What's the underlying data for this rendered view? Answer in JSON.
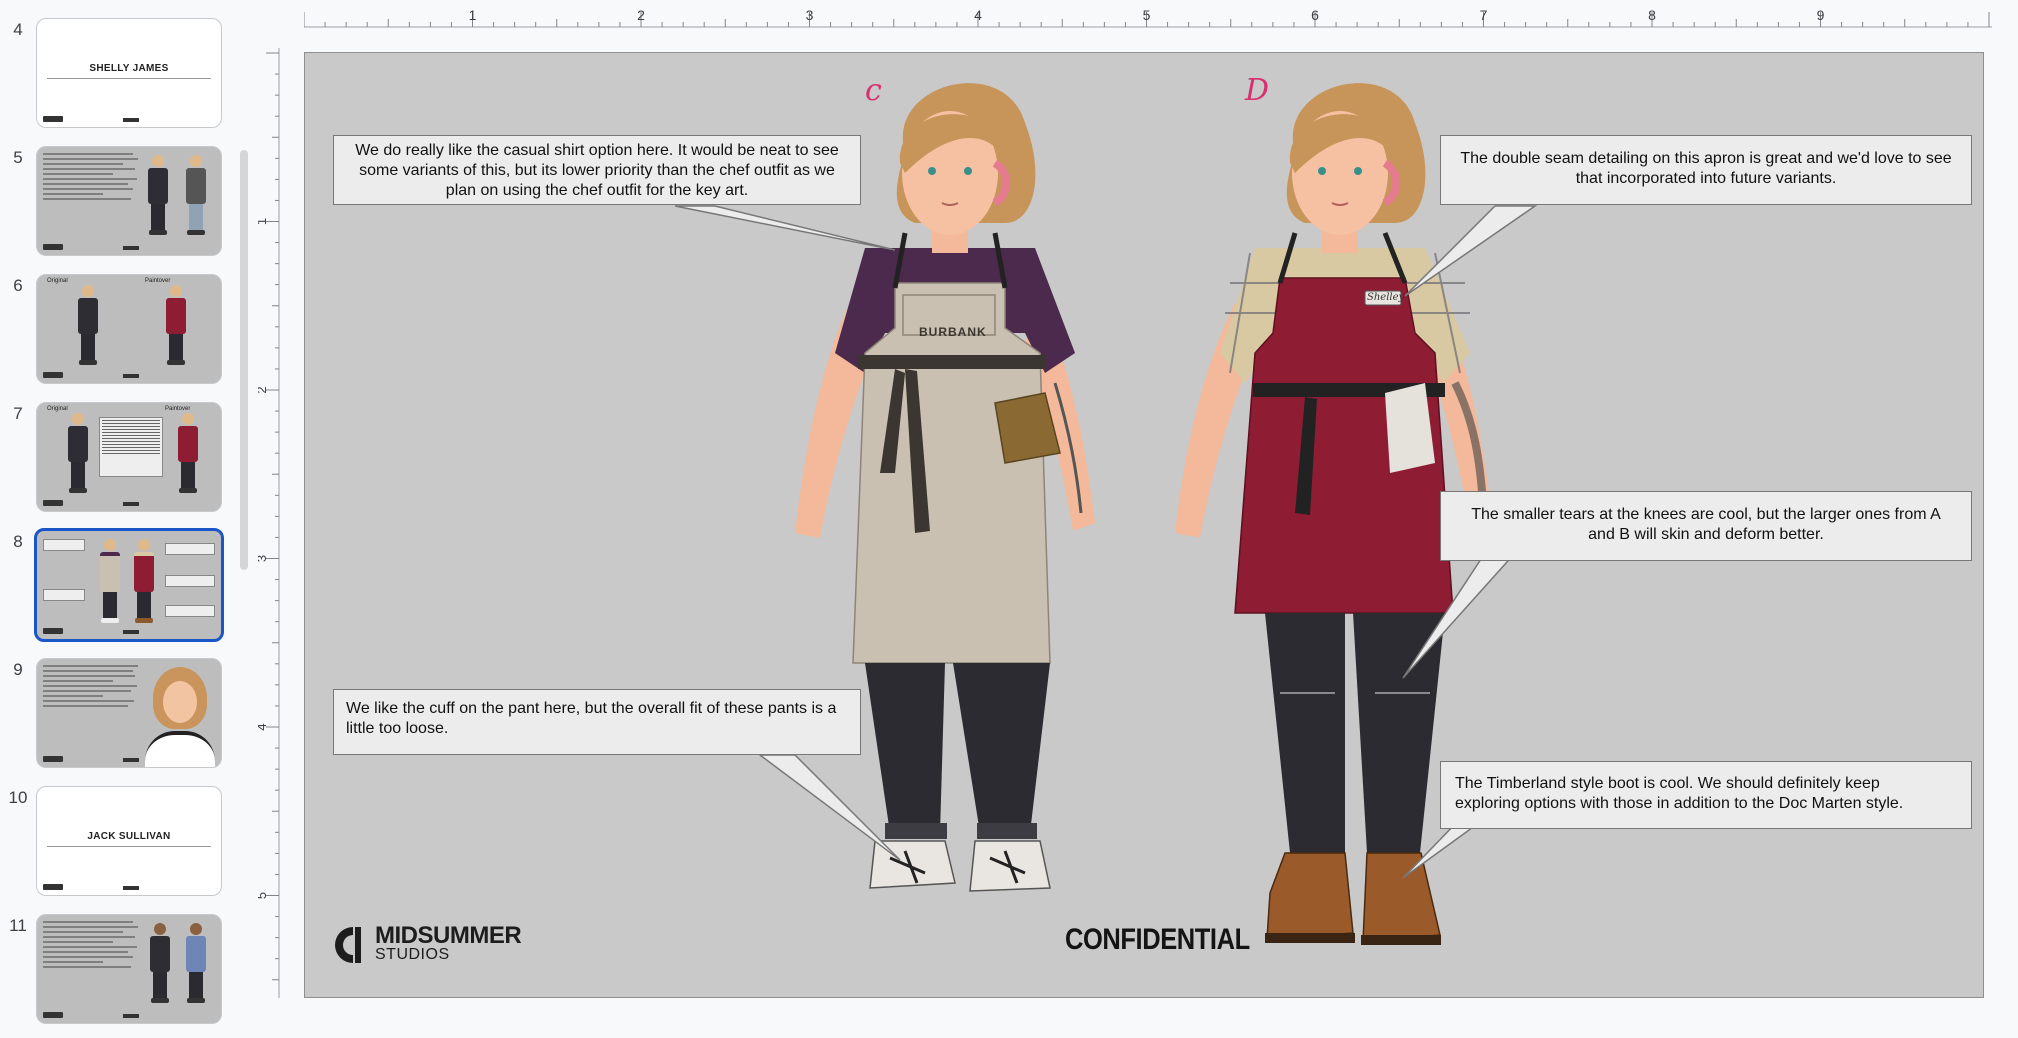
{
  "filmstrip": {
    "slides": [
      {
        "number": "4",
        "title": "SHELLY JAMES",
        "kind": "title"
      },
      {
        "number": "5",
        "kind": "text-figures"
      },
      {
        "number": "6",
        "label_left": "Original",
        "label_right": "Paintover",
        "kind": "compare"
      },
      {
        "number": "7",
        "label_left": "Original",
        "label_right": "Paintover",
        "kind": "compare-notes"
      },
      {
        "number": "8",
        "kind": "callouts",
        "selected": true
      },
      {
        "number": "9",
        "kind": "portrait"
      },
      {
        "number": "10",
        "title": "JACK SULLIVAN",
        "kind": "title"
      },
      {
        "number": "11",
        "kind": "text-figures"
      }
    ]
  },
  "rulers": {
    "horizontal": [
      "1",
      "2",
      "3",
      "4",
      "5",
      "6",
      "7",
      "8",
      "9"
    ],
    "vertical": [
      "1",
      "2",
      "3",
      "4",
      "5"
    ]
  },
  "slide": {
    "letters": {
      "left": "c",
      "right": "D"
    },
    "callouts": [
      {
        "id": "shirt",
        "lines": [
          "We do really like the casual shirt option here. It would be neat to see",
          "some variants of this, but its lower priority than the chef outfit as we",
          "plan on using the chef outfit for the key art."
        ]
      },
      {
        "id": "pants",
        "lines": [
          "We like the cuff on the pant here, but the overall fit of these pants is a",
          "little too loose."
        ]
      },
      {
        "id": "seam",
        "lines": [
          "The double seam detailing on this apron is great and we'd love to see",
          "that incorporated into future variants."
        ]
      },
      {
        "id": "tears",
        "lines": [
          "The smaller tears at the knees are cool, but the larger ones from A",
          "and B will skin and deform better."
        ]
      },
      {
        "id": "boot",
        "lines": [
          "The Timberland style boot is cool. We should definitely keep",
          "exploring options with those in addition to the Doc Marten style."
        ]
      }
    ],
    "apron_text_left": "BURBANK",
    "name_tag_right": "Shelley",
    "logo": {
      "line1": "MIDSUMMER",
      "line2": "STUDIOS"
    },
    "confidential": "CONFIDENTIAL"
  },
  "colors": {
    "slide_bg": "#c9c9c9",
    "callout_bg": "#ececec",
    "selection": "#1a56c8",
    "apron_left": "#c9c0b1",
    "apron_right": "#8e1d33",
    "shirt_left": "#4b2a4d",
    "plaid": "#d8c9a3",
    "letter_mark": "#d7306f"
  }
}
